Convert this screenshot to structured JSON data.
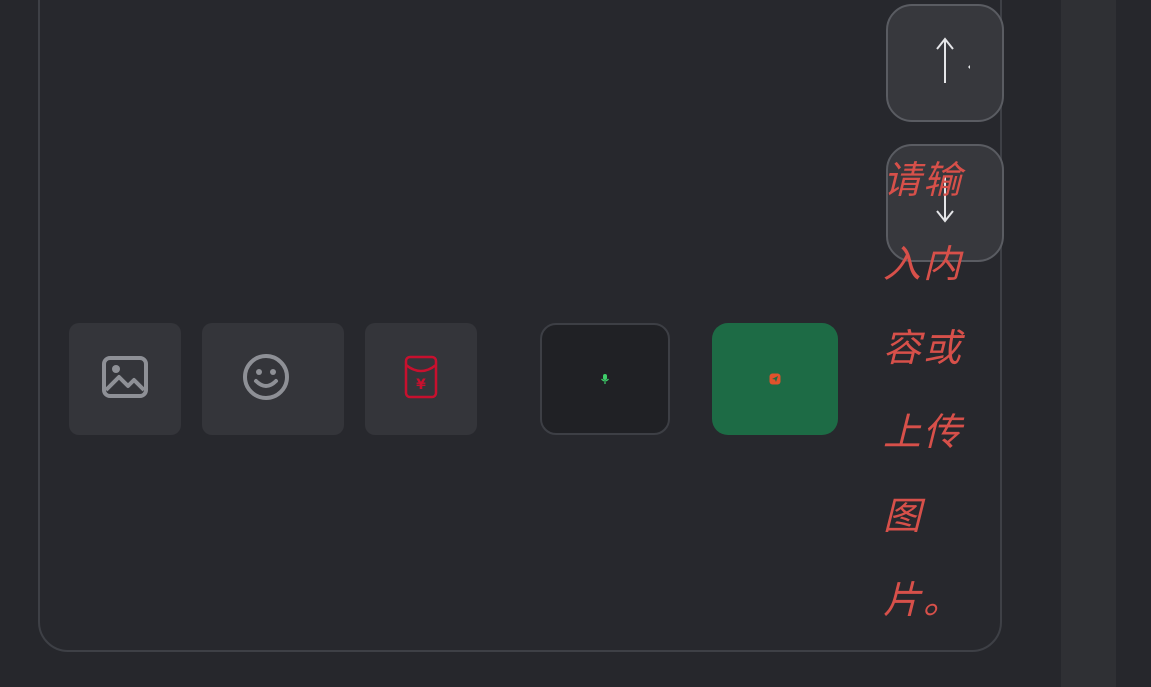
{
  "composer": {
    "placeholder": "请输入内容或上传图片。"
  },
  "toolbar": {
    "image_icon": "image-icon",
    "emoji_icon": "smiley-icon",
    "red_packet_icon": "red-packet-icon",
    "red_packet_symbol": "¥"
  },
  "actions": {
    "voice_icon": "microphone-icon",
    "send_icon": "send-icon",
    "scroll_up_icon": "arrow-up-icon",
    "scroll_down_icon": "arrow-down-icon"
  },
  "colors": {
    "background": "#26272c",
    "panel": "#27282d",
    "tool_button": "#34353a",
    "send_button": "#1d6b45",
    "placeholder_text": "#d7504a",
    "red_packet": "#c8102e",
    "mic": "#3ecf6a"
  }
}
